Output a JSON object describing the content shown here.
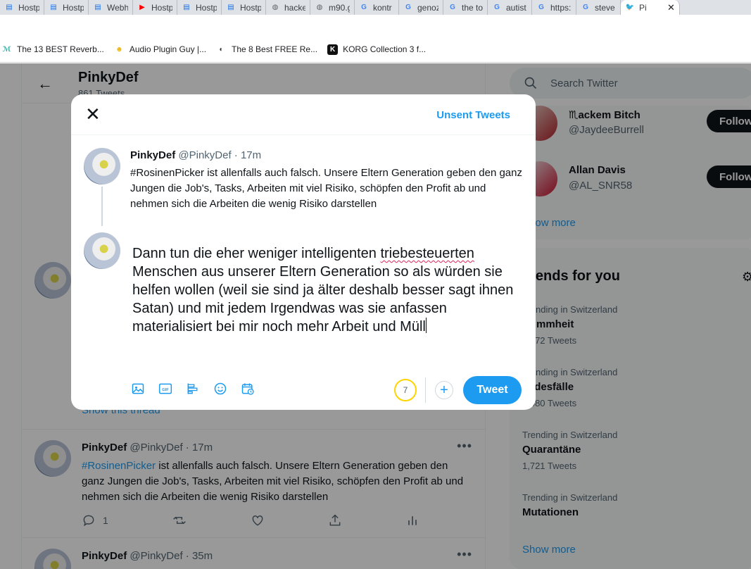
{
  "browser": {
    "tabs": [
      {
        "title": "Hostp",
        "icon": "document-icon",
        "color": "#1a73e8"
      },
      {
        "title": "Hostp",
        "icon": "document-icon",
        "color": "#1a73e8"
      },
      {
        "title": "Webh",
        "icon": "document-icon",
        "color": "#1a73e8"
      },
      {
        "title": "Hostp",
        "icon": "youtube-icon",
        "color": "#ff0000"
      },
      {
        "title": "Hostp",
        "icon": "document-icon",
        "color": "#1a73e8"
      },
      {
        "title": "Hostp",
        "icon": "document-icon",
        "color": "#1a73e8"
      },
      {
        "title": "hacke",
        "icon": "globe-icon",
        "color": "#5f6368"
      },
      {
        "title": "m90.g",
        "icon": "globe-icon",
        "color": "#5f6368"
      },
      {
        "title": "kontr",
        "icon": "google-icon",
        "color": "#4285f4"
      },
      {
        "title": "genoz",
        "icon": "google-icon",
        "color": "#4285f4"
      },
      {
        "title": "the to",
        "icon": "google-icon",
        "color": "#4285f4"
      },
      {
        "title": "autist",
        "icon": "google-icon",
        "color": "#4285f4"
      },
      {
        "title": "https:",
        "icon": "google-icon",
        "color": "#4285f4"
      },
      {
        "title": "steve",
        "icon": "google-icon",
        "color": "#4285f4"
      },
      {
        "title": "Pi",
        "icon": "twitter-icon",
        "color": "#1d9bf0"
      }
    ],
    "bookmarks": [
      {
        "title": "The 13 BEST Reverb...",
        "icon": "waves-icon"
      },
      {
        "title": "Audio Plugin Guy |...",
        "icon": "face-icon"
      },
      {
        "title": "The 8 Best FREE Re...",
        "icon": "moon-icon"
      },
      {
        "title": "KORG Collection 3 f...",
        "icon": "korg-icon"
      }
    ]
  },
  "profile": {
    "name": "PinkyDef",
    "tweet_count": "861 Tweets"
  },
  "timeline": {
    "show_thread": "Show this thread",
    "tweets": [
      {
        "name": "PinkyDef",
        "handle": "@PinkyDef",
        "time": "· 17m",
        "hashtag": "#RosinenPicker",
        "text": " ist allenfalls auch falsch. Unsere Eltern Generation geben den ganz Jungen die Job's, Tasks, Arbeiten mit viel Risiko, schöpfen den Profit ab und nehmen sich die Arbeiten die wenig Risiko darstellen",
        "replies": "1"
      },
      {
        "name": "PinkyDef",
        "handle": "@PinkyDef",
        "time": "· 35m"
      }
    ]
  },
  "sidebar": {
    "search_placeholder": "Search Twitter",
    "who_to_follow": [
      {
        "name": "♏ackem Bitch",
        "handle": "@JaydeeBurrell",
        "button": "Follow"
      },
      {
        "name": "Allan Davis",
        "handle": "@AL_SNR58",
        "button": "Follow"
      }
    ],
    "show_more_1": "Show more",
    "trends_title": "Trends for you",
    "trends": [
      {
        "context": "Trending in Switzerland",
        "name": "Dummheit",
        "count": "2,572 Tweets"
      },
      {
        "context": "Trending in Switzerland",
        "name": "Todesfälle",
        "count": "1,080 Tweets"
      },
      {
        "context": "Trending in Switzerland",
        "name": "Quarantäne",
        "count": "1,721 Tweets"
      },
      {
        "context": "Trending in Switzerland",
        "name": "Mutationen",
        "count": ""
      }
    ],
    "show_more_2": "Show more"
  },
  "modal": {
    "unsent_label": "Unsent Tweets",
    "prev_tweet": {
      "name": "PinkyDef",
      "handle": "@PinkyDef",
      "time": "· 17m",
      "text": "#RosinenPicker ist allenfalls auch falsch. Unsere Eltern Generation geben den ganz Jungen die Job's, Tasks, Arbeiten mit viel Risiko, schöpfen den Profit ab und nehmen sich die Arbeiten die wenig Risiko darstellen"
    },
    "draft": {
      "before": "Dann tun die eher weniger intelligenten ",
      "misspelled": "triebesteuerten",
      "after": " Menschen aus unserer Eltern Generation so als würden sie helfen wollen (weil sie sind ja älter deshalb besser sagt ihnen Satan) und mit jedem Irgendwas was sie anfassen materialisiert bei mir noch mehr Arbeit und Müll"
    },
    "remaining_chars": "7",
    "tweet_button": "Tweet",
    "tools": [
      "image-icon",
      "gif-icon",
      "poll-icon",
      "emoji-icon",
      "schedule-icon"
    ]
  },
  "colors": {
    "accent": "#1d9bf0",
    "counter_warning": "#ffd400",
    "spellcheck": "#e0245e"
  }
}
